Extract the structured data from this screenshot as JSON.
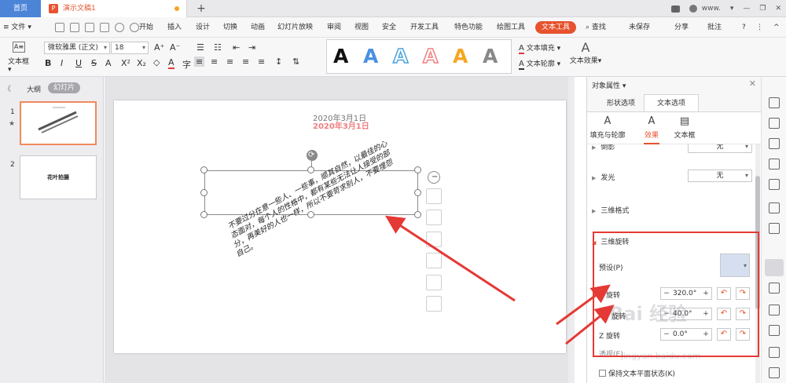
{
  "titlebar": {
    "home_tab": "首页",
    "doc_icon": "P",
    "doc_title": "演示文稿1",
    "add_tab": "+",
    "page_badge": "1",
    "user": "www.",
    "user_menu": "▾",
    "minimize": "—",
    "restore": "❐",
    "close": "✕"
  },
  "menubar": {
    "hamburger": "≡",
    "file": "文件",
    "file_caret": "▾",
    "items": [
      "开始",
      "插入",
      "设计",
      "切换",
      "动画",
      "幻灯片放映",
      "审阅",
      "视图",
      "安全",
      "开发工具",
      "特色功能",
      "绘图工具",
      "文本工具"
    ],
    "search": "查找",
    "unsaved": "未保存",
    "share": "分享",
    "comment": "批注",
    "help": "?",
    "more": "⋮",
    "collapse": "^"
  },
  "ribbon": {
    "textbox_label": "文本框",
    "textbox_caret": "▾",
    "font_name": "微软雅黑 (正文)",
    "font_size": "18",
    "font_name_caret": "▾",
    "font_size_caret": "▾",
    "grow_font": "A⁺",
    "shrink_font": "A⁻",
    "bold": "B",
    "italic": "I",
    "underline": "U",
    "strike": "S",
    "shadow": "A",
    "superscript": "X²",
    "subscript": "X₂",
    "clear_format": "◇",
    "font_color": "A",
    "char_spacing": "字",
    "bullets": "☰",
    "numbering": "☷",
    "indent_less": "⇤",
    "indent_more": "⇥",
    "align_left": "≡",
    "align_center": "≡",
    "align_right": "≡",
    "justify": "≡",
    "distribute": "≡",
    "line_spacing": "↕",
    "text_direction": "⇅",
    "text_fill": "文本填充",
    "text_outline": "文本轮廓",
    "text_effect": "文本效果",
    "text_fill_caret": "▾",
    "text_outline_caret": "▾",
    "text_effect_caret": "▾",
    "text_effect_icon": "A",
    "fill_icon": "A",
    "outline_icon": "A",
    "wordart_colors": [
      "#111111",
      "#4a90e2",
      "#4aa3df",
      "#f08080",
      "#f5a623",
      "#888888"
    ],
    "wordart_letter": "A"
  },
  "leftpanel": {
    "collapse": "《",
    "outline_tab": "大纲",
    "slides_tab": "幻灯片",
    "slide1_num": "1",
    "slide1_star": "★",
    "slide2_num": "2",
    "slide2_title": "花叶拍摄"
  },
  "slide": {
    "date": "2020年3月1日",
    "date_reflection": "2020年3月1日",
    "rotate_icon": "⟳",
    "text_lines": [
      "不要过分在意一些人、一些事，顺其自然，以最佳的心",
      "态面对，每个人的性格中，都有某些无法让人接受的部",
      "分，再美好的人也一样，所以不要苛求别人，不要埋怨",
      "自己。"
    ]
  },
  "float_tools": {
    "minus": "−",
    "icons": [
      "text-wrap",
      "layers",
      "pen",
      "fill",
      "frame",
      "textbox"
    ]
  },
  "rightpanel": {
    "title": "对象属性",
    "title_caret": "▾",
    "close": "✕",
    "tab_shape": "形状选项",
    "tab_text": "文本选项",
    "subtab_fill": "填充与轮廓",
    "subtab_effect": "效果",
    "subtab_box": "文本框",
    "subtab_fill_icon": "A",
    "subtab_effect_icon": "A",
    "subtab_box_icon": "▤",
    "partial_row": "倒影",
    "partial_value": "无",
    "glow_label": "发光",
    "glow_value": "无",
    "threed_format": "三维格式",
    "threed_rotation": "三维旋转",
    "preset_label": "预设(P)",
    "x_label": "X 旋转",
    "x_value": "320.0°",
    "y_label": "Y 旋转",
    "y_value": "40.0°",
    "z_label": "Z 旋转",
    "z_value": "0.0°",
    "persp_label": "透视(E)",
    "keep_flat": "保持文本平面状态(K)",
    "minus": "−",
    "plus": "+",
    "tri_right": "▶",
    "tri_down": "◢",
    "caret": "▾"
  },
  "watermark": {
    "brand": "Bai 经验",
    "url": "jingyan.baidu.com"
  },
  "colors": {
    "accent": "#e6532e",
    "home_tab": "#4c84d8",
    "annotation_red": "#e53935"
  }
}
